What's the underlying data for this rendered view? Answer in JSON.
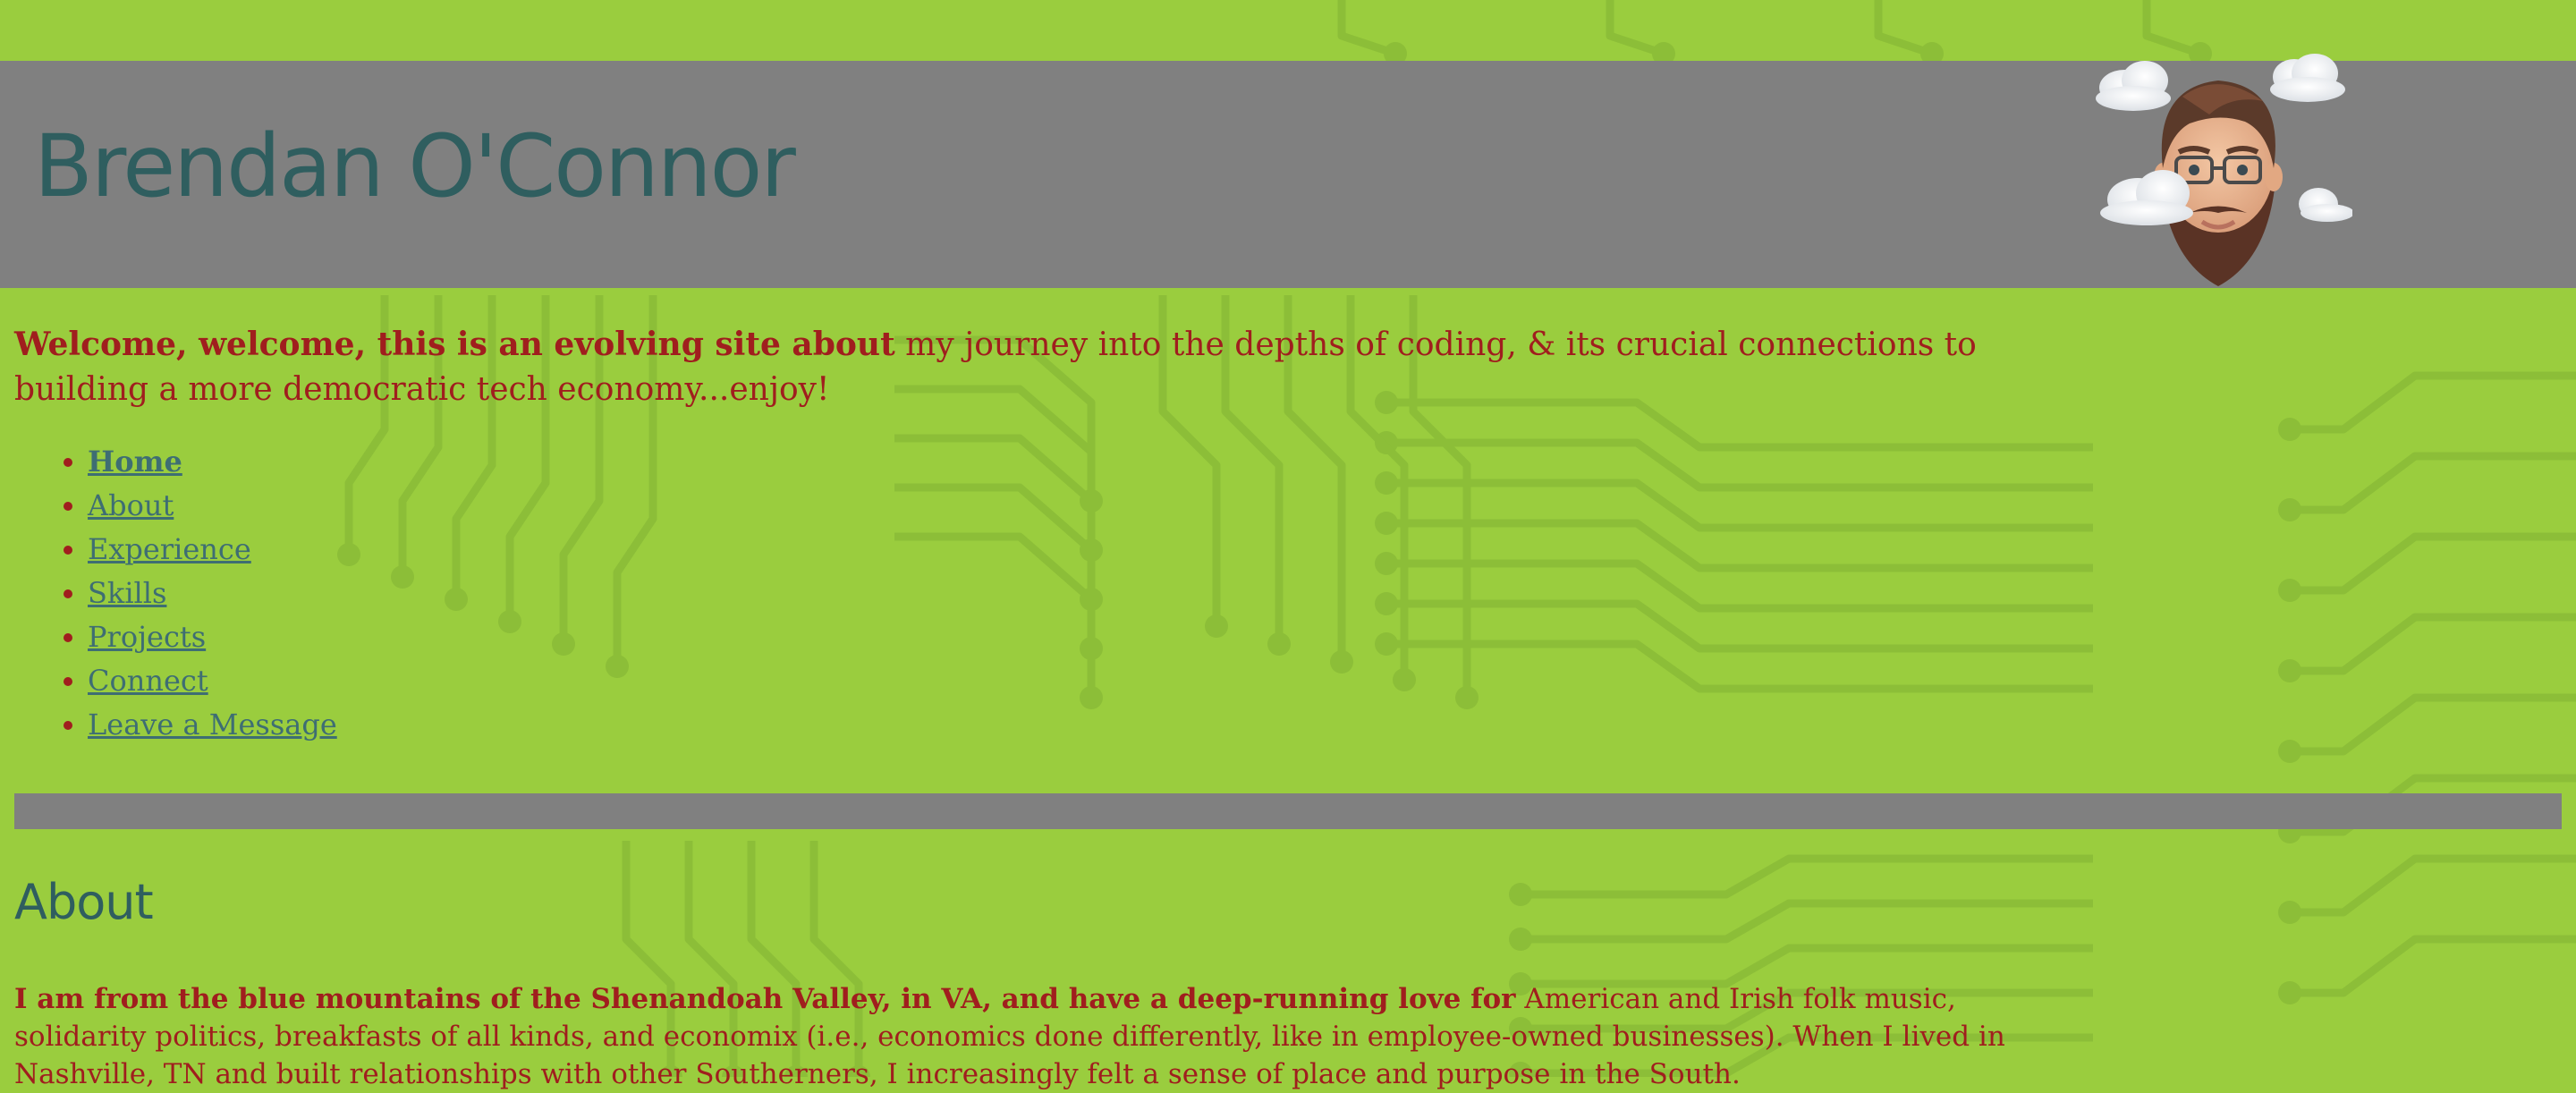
{
  "colors": {
    "page_background": "#9acd3e",
    "header_band": "#808080",
    "title_text": "#2f5e5f",
    "body_text": "#a01e1e",
    "link_text": "#3e6e73"
  },
  "header": {
    "title": "Brendan O'Connor",
    "avatar_icon": "memoji-avatar-with-clouds"
  },
  "intro": {
    "bold_lead": "Welcome, welcome, this is an evolving site about",
    "rest": " my journey into the depths of coding, & its crucial connections to building a more democratic tech economy...enjoy!"
  },
  "nav": {
    "items": [
      {
        "label": "Home",
        "active": true
      },
      {
        "label": "About",
        "active": false
      },
      {
        "label": "Experience",
        "active": false
      },
      {
        "label": "Skills",
        "active": false
      },
      {
        "label": "Projects",
        "active": false
      },
      {
        "label": "Connect",
        "active": false
      },
      {
        "label": "Leave a Message",
        "active": false
      }
    ]
  },
  "about": {
    "heading": "About",
    "bold_lead": "I am from the blue mountains of the Shenandoah Valley, in VA, and have a deep-running love for",
    "rest": " American and Irish folk music, solidarity politics, breakfasts of all kinds, and economix (i.e., economics done differently, like in employee-owned businesses). When I lived in Nashville, TN and built relationships with other Southerners, I increasingly felt a sense of place and purpose in the South."
  }
}
